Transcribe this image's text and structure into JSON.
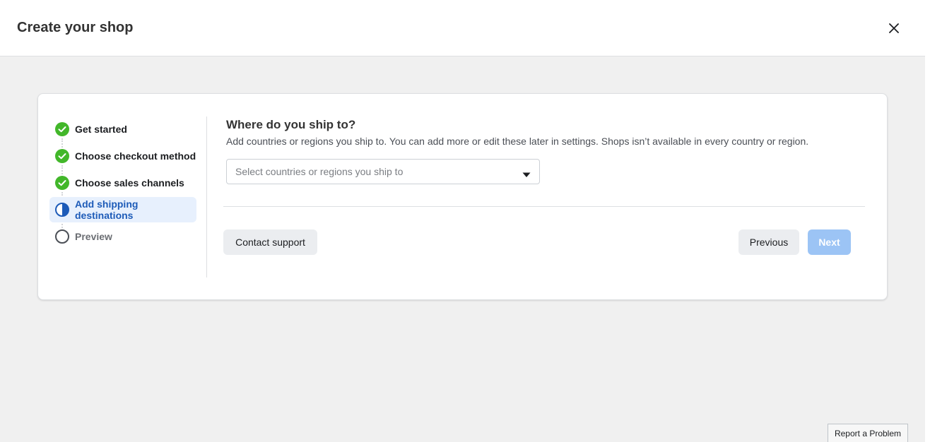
{
  "header": {
    "title": "Create your shop",
    "close_icon": "close-icon"
  },
  "steps": [
    {
      "label": "Get started",
      "status": "done"
    },
    {
      "label": "Choose checkout method",
      "status": "done"
    },
    {
      "label": "Choose sales channels",
      "status": "done"
    },
    {
      "label": "Add shipping destinations",
      "status": "current"
    },
    {
      "label": "Preview",
      "status": "pending"
    }
  ],
  "main": {
    "title": "Where do you ship to?",
    "description": "Add countries or regions you ship to. You can add more or edit these later in settings. Shops isn’t available in every country or region.",
    "select_placeholder": "Select countries or regions you ship to"
  },
  "footer": {
    "contact_label": "Contact support",
    "previous_label": "Previous",
    "next_label": "Next"
  },
  "report_label": "Report a Problem",
  "colors": {
    "done": "#42b72a",
    "current": "#1d5bb8",
    "accent_disabled": "#9cc4f5"
  }
}
